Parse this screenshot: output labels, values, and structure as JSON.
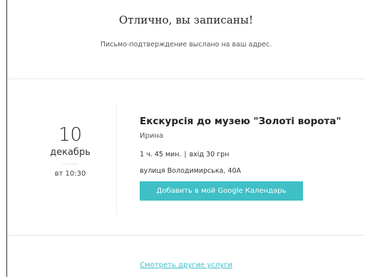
{
  "confirmation": {
    "title": "Отлично, вы записаны!",
    "subtitle": "Письмо-подтверждение выслано на ваш адрес."
  },
  "booking": {
    "date": {
      "day": "10",
      "month": "декабрь",
      "weekday_time": "вт 10:30"
    },
    "service_title": "Екскурсія до музею \"Золоті ворота\"",
    "staff_name": "Ирина",
    "duration": "1 ч. 45 мин.",
    "separator": "|",
    "price": "вхід 30 грн",
    "address": "вулиця Володимирська, 40А",
    "calendar_button_label": "Добавить в мой Google Календарь"
  },
  "footer": {
    "other_services_label": "Смотреть другие услуги"
  },
  "colors": {
    "accent": "#3fbfc6",
    "text": "#222222",
    "divider": "#e6e6e6"
  }
}
